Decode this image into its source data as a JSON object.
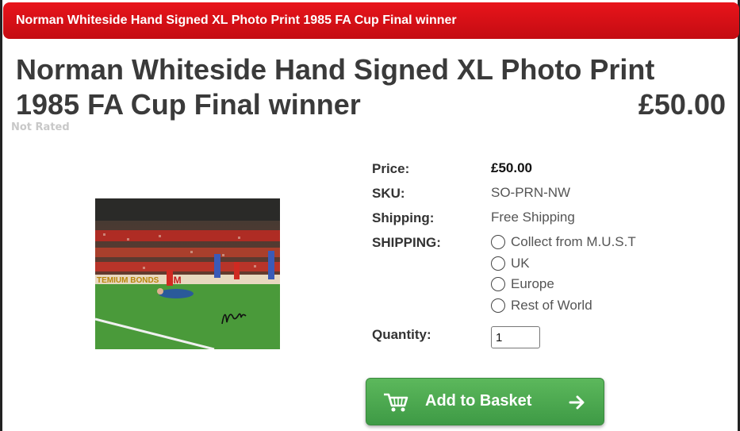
{
  "banner": {
    "title": "Norman Whiteside Hand Signed XL Photo Print 1985 FA Cup Final winner"
  },
  "product": {
    "title": "Norman Whiteside Hand Signed XL Photo Print 1985 FA Cup Final winner",
    "price_display": "£50.00",
    "rating_text": "Not Rated"
  },
  "details": {
    "price_label": "Price:",
    "price_value": "£50.00",
    "sku_label": "SKU:",
    "sku_value": "SO-PRN-NW",
    "shipping_label": "Shipping:",
    "shipping_value": "Free Shipping",
    "shipping_option_label": "SHIPPING:",
    "shipping_options": [
      "Collect from M.U.S.T",
      "UK",
      "Europe",
      "Rest of World"
    ],
    "quantity_label": "Quantity:",
    "quantity_value": "1"
  },
  "actions": {
    "add_to_basket": "Add to Basket"
  },
  "colors": {
    "banner": "#d9101a",
    "button": "#4cab50",
    "title": "#3a3a3a"
  },
  "icons": {
    "cart": "cart-icon",
    "arrow": "arrow-right-icon"
  }
}
